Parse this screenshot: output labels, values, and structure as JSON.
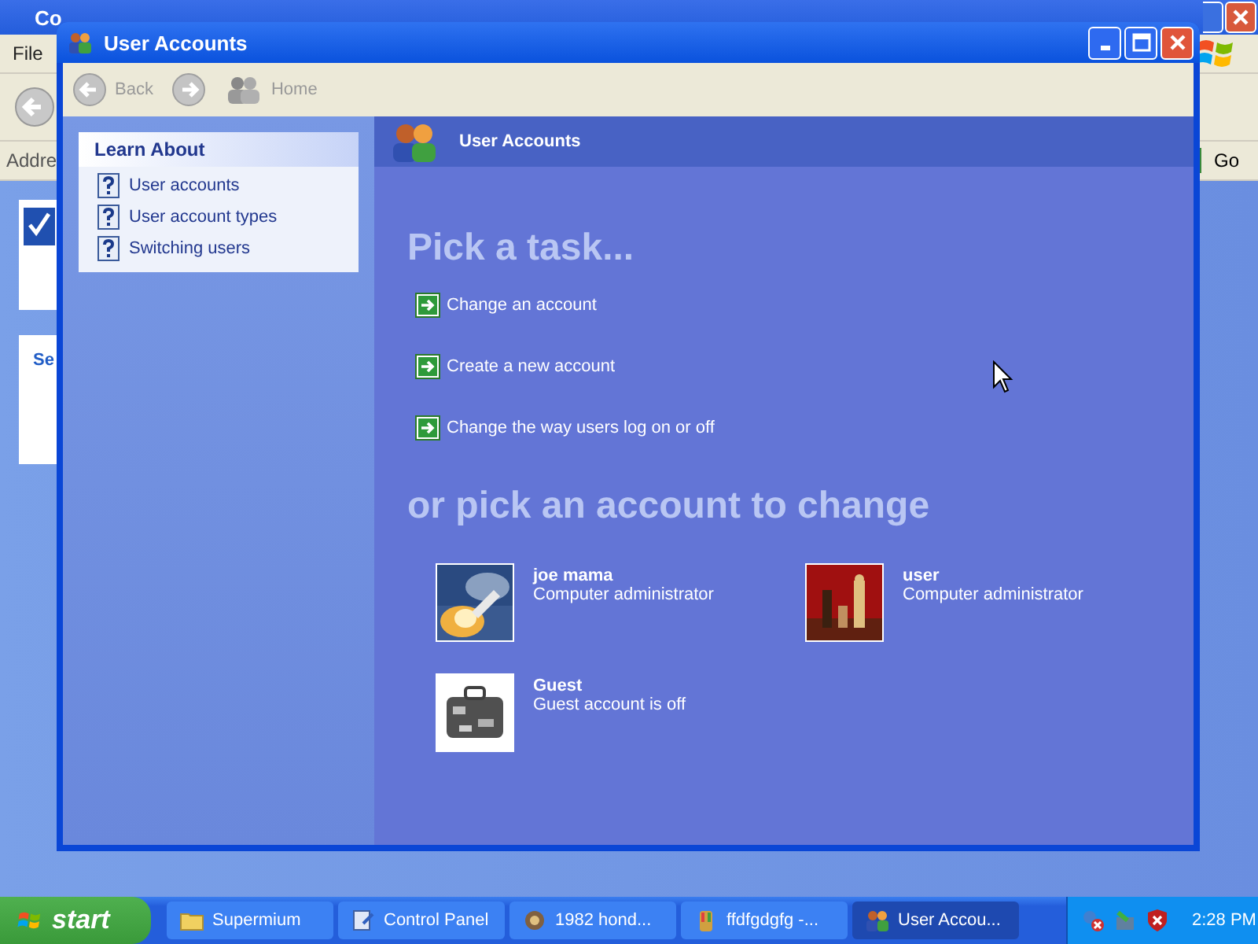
{
  "background_window": {
    "title": "Co",
    "menu": [
      "File"
    ],
    "address_label": "Addre",
    "go_button": "Go",
    "panel_heading": "Se"
  },
  "window": {
    "title": "User Accounts"
  },
  "toolbar": {
    "back": "Back",
    "home": "Home"
  },
  "learn_about": {
    "title": "Learn About",
    "items": [
      "User accounts",
      "User account types",
      "Switching users"
    ]
  },
  "header": "User Accounts",
  "tasks": {
    "heading": "Pick a task...",
    "items": [
      "Change an account",
      "Create a new account",
      "Change the way users log on or off"
    ]
  },
  "accounts": {
    "heading": "or pick an account to change",
    "items": [
      {
        "name": "joe mama",
        "description": "Computer administrator"
      },
      {
        "name": "user",
        "description": "Computer administrator"
      },
      {
        "name": "Guest",
        "description": "Guest account is off"
      }
    ]
  },
  "taskbar": {
    "start": "start",
    "tasks": [
      {
        "label": "Supermium",
        "kind": "folder",
        "selected": false
      },
      {
        "label": "Control Panel",
        "kind": "panel",
        "selected": false
      },
      {
        "label": "1982 hond...",
        "kind": "app",
        "selected": false
      },
      {
        "label": "ffdfgdgfg -...",
        "kind": "paint",
        "selected": false
      },
      {
        "label": "User Accou...",
        "kind": "users",
        "selected": true
      }
    ],
    "clock": "2:28 PM"
  }
}
